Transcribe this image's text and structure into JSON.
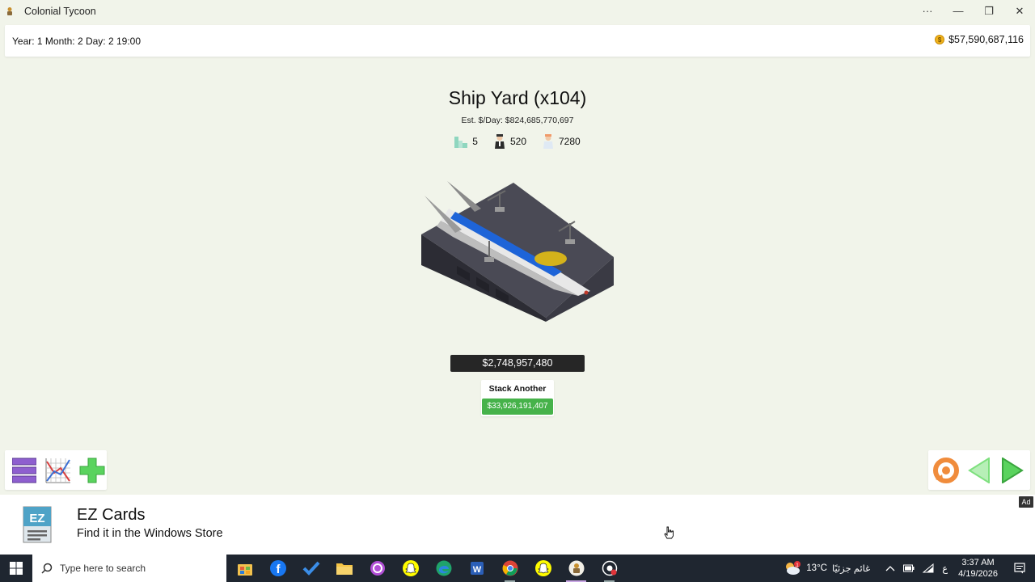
{
  "window": {
    "title": "Colonial Tycoon",
    "controls": {
      "more": "···",
      "minimize": "—",
      "restore": "❐",
      "close": "✕"
    }
  },
  "topbar": {
    "date": "Year: 1 Month: 2 Day: 2 19:00",
    "money": "$57,590,687,116",
    "coin_icon": "$"
  },
  "building": {
    "name": "Ship Yard (x104)",
    "est_per_day": "Est. $/Day: $824,685,770,697",
    "stats": [
      {
        "icon": "buildings-icon",
        "value": "5"
      },
      {
        "icon": "manager-icon",
        "value": "520"
      },
      {
        "icon": "worker-icon",
        "value": "7280"
      }
    ],
    "price": "$2,748,957,480",
    "stack_label": "Stack Another",
    "stack_price": "$33,926,191,407"
  },
  "toolbar_left": {
    "buttons": [
      "menu-list-icon",
      "chart-icon",
      "add-icon"
    ],
    "colors": {
      "menu": "#8e5fcf",
      "add": "#5ad35e"
    }
  },
  "toolbar_right": {
    "buttons": [
      "refresh-icon",
      "prev-arrow-icon",
      "next-arrow-icon"
    ],
    "colors": {
      "refresh": "#f08c3c",
      "arrows": "#7ee07e"
    }
  },
  "ad": {
    "logo_text": "EZ",
    "title": "EZ Cards",
    "subtitle": "Find it in the Windows Store",
    "tag": "Ad"
  },
  "taskbar": {
    "search_placeholder": "Type here to search",
    "weather_temp": "13°C",
    "weather_text": "غائم جزئيًا",
    "weather_badge": "1",
    "lang": "ع",
    "time": "3:37 AM",
    "date": "4/19/2026"
  }
}
